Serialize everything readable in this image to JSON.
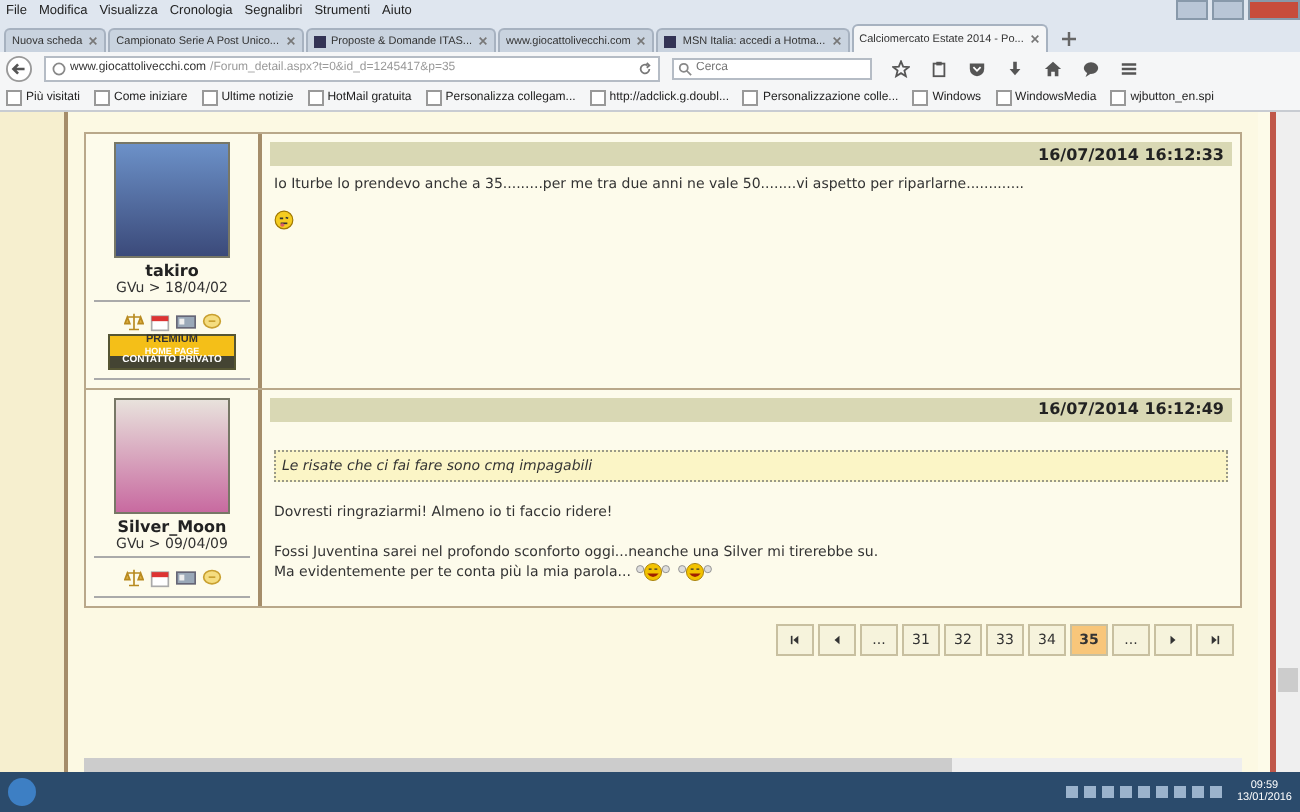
{
  "menu_bar": [
    "File",
    "Modifica",
    "Visualizza",
    "Cronologia",
    "Segnalibri",
    "Strumenti",
    "Aiuto"
  ],
  "tabs": [
    {
      "label": "Nuova scheda",
      "selected": false,
      "icon": false
    },
    {
      "label": "Campionato Serie A Post Unico...",
      "selected": false,
      "icon": false
    },
    {
      "label": "Proposte & Domande ITAS...",
      "selected": false,
      "icon": true
    },
    {
      "label": "www.giocattolivecchi.com",
      "selected": false,
      "icon": false
    },
    {
      "label": "MSN Italia: accedi a Hotma...",
      "selected": false,
      "icon": true
    },
    {
      "label": "Calciomercato Estate 2014 - Po...",
      "selected": true,
      "icon": false
    }
  ],
  "address": {
    "domain": "www.giocattolivecchi.com",
    "path": "/Forum_detail.aspx?t=0&id_d=1245417&p=35"
  },
  "search": {
    "placeholder": "Cerca"
  },
  "bookmarks": [
    "Più visitati",
    "Come iniziare",
    "Ultime notizie",
    "HotMail gratuita",
    "Personalizza collegam...",
    "http://adclick.g.doubl...",
    "Personalizzazione colle...",
    "Windows",
    "WindowsMedia",
    "wjbutton_en.spi"
  ],
  "posts": [
    {
      "user": {
        "name": "takiro",
        "joined": "GVu > 18/04/02",
        "premium_badge": {
          "title": "PREMIUM",
          "subtitle": "HOME PAGE",
          "contact": "CONTATTO PRIVATO"
        }
      },
      "date": "16/07/2014 16:12:33",
      "blocks": [
        {
          "kind": "text",
          "text": "Io Iturbe lo prendevo anche a 35.........per me tra due anni ne vale 50........vi aspetto per riparlarne............."
        },
        {
          "kind": "smileys",
          "smileys": [
            {
              "kind": "tongue"
            }
          ]
        }
      ]
    },
    {
      "user": {
        "name": "Silver_Moon",
        "joined": "GVu > 09/04/09"
      },
      "date": "16/07/2014 16:12:49",
      "blocks": [
        {
          "kind": "gap"
        },
        {
          "kind": "quote",
          "text": "Le risate che ci fai fare sono cmq impagabili"
        },
        {
          "kind": "gap"
        },
        {
          "kind": "text",
          "text": "Dovresti ringraziarmi! Almeno io ti faccio ridere!"
        },
        {
          "kind": "gap"
        },
        {
          "kind": "text",
          "text": "Fossi Juventina sarei nel profondo sconforto oggi...neanche una Silver mi tirerebbe su."
        },
        {
          "kind": "text",
          "text": "Ma evidentemente per te conta più la mia parola...",
          "smileys": [
            {
              "kind": "laugh"
            },
            {
              "kind": "laugh"
            }
          ]
        }
      ]
    }
  ],
  "pagination": [
    {
      "kind": "first"
    },
    {
      "kind": "prev"
    },
    {
      "kind": "page",
      "label": "...",
      "selected": false
    },
    {
      "kind": "page",
      "label": "31",
      "selected": false
    },
    {
      "kind": "page",
      "label": "32",
      "selected": false
    },
    {
      "kind": "page",
      "label": "33",
      "selected": false
    },
    {
      "kind": "page",
      "label": "34",
      "selected": false
    },
    {
      "kind": "page",
      "label": "35",
      "selected": true
    },
    {
      "kind": "page",
      "label": "...",
      "selected": false
    },
    {
      "kind": "next"
    },
    {
      "kind": "last"
    }
  ],
  "taskbar": {
    "time": "09:59",
    "date": "13/01/2016"
  }
}
